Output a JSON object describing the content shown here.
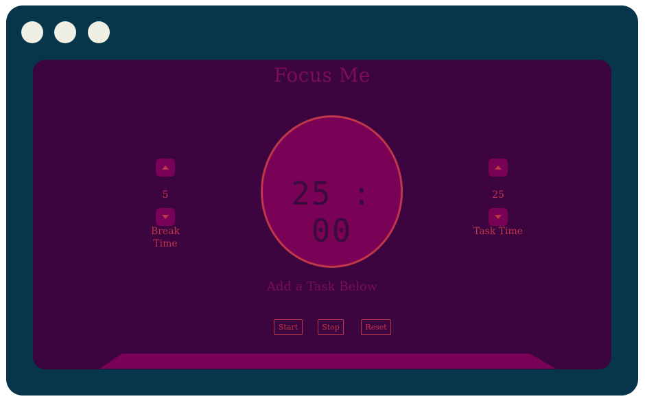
{
  "app": {
    "title": "Focus Me",
    "timer_display": "25 : 00",
    "task_prompt": "Add a Task Below"
  },
  "break_stepper": {
    "value": "5",
    "label": "Break Time"
  },
  "task_stepper": {
    "value": "25",
    "label": "Task Time"
  },
  "controls": {
    "start_label": "Start",
    "stop_label": "Stop",
    "reset_label": "Reset"
  },
  "colors": {
    "window_frame": "#07364a",
    "window_dots": "#eff0e3",
    "app_background": "#3d0540",
    "accent_magenta": "#7a0256",
    "accent_red": "#c0364a"
  },
  "icons": {
    "increment": "caret-up-icon",
    "decrement": "caret-down-icon"
  }
}
